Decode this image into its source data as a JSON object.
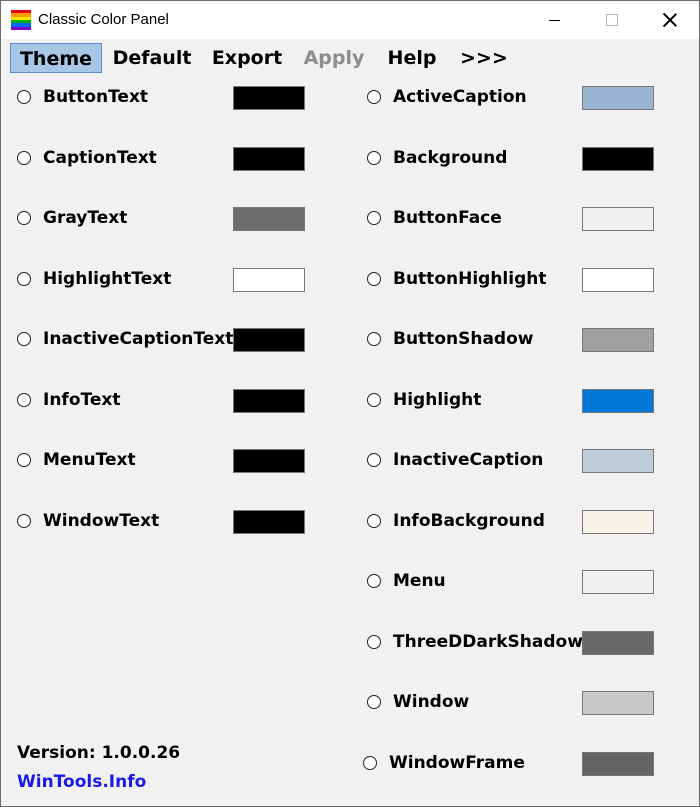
{
  "window": {
    "title": "Classic Color Panel",
    "icon": "rainbow-stripes-icon",
    "icon_colors": [
      "#e60000",
      "#ff9900",
      "#ffe600",
      "#00b300",
      "#0066ff",
      "#7a00cc"
    ]
  },
  "menu": [
    {
      "label": "Theme",
      "state": "active"
    },
    {
      "label": "Default",
      "state": "normal"
    },
    {
      "label": "Export",
      "state": "normal"
    },
    {
      "label": "Apply",
      "state": "disabled"
    },
    {
      "label": "Help",
      "state": "normal"
    },
    {
      "label": ">>>",
      "state": "normal"
    }
  ],
  "left_colors": [
    {
      "label": "ButtonText",
      "color": "#000000"
    },
    {
      "label": "CaptionText",
      "color": "#000000"
    },
    {
      "label": "GrayText",
      "color": "#6d6d6d"
    },
    {
      "label": "HighlightText",
      "color": "#ffffff"
    },
    {
      "label": "InactiveCaptionText",
      "color": "#000000"
    },
    {
      "label": "InfoText",
      "color": "#000000"
    },
    {
      "label": "MenuText",
      "color": "#000000"
    },
    {
      "label": "WindowText",
      "color": "#000000"
    }
  ],
  "right_colors": [
    {
      "label": "ActiveCaption",
      "color": "#99b4d1"
    },
    {
      "label": "Background",
      "color": "#000000"
    },
    {
      "label": "ButtonFace",
      "color": "#f0f0f0"
    },
    {
      "label": "ButtonHighlight",
      "color": "#ffffff"
    },
    {
      "label": "ButtonShadow",
      "color": "#a0a0a0"
    },
    {
      "label": "Highlight",
      "color": "#0078d7"
    },
    {
      "label": "InactiveCaption",
      "color": "#bfcddb"
    },
    {
      "label": "InfoBackground",
      "color": "#f6f2e8"
    },
    {
      "label": "Menu",
      "color": "#f0f0f0"
    },
    {
      "label": "ThreeDDarkShadow",
      "color": "#696969"
    },
    {
      "label": "Window",
      "color": "#c8c8c8"
    },
    {
      "label": "WindowFrame",
      "color": "#646464"
    }
  ],
  "footer": {
    "version": "Version: 1.0.0.26",
    "link": "WinTools.Info",
    "link_color": "#1a1ae6"
  }
}
